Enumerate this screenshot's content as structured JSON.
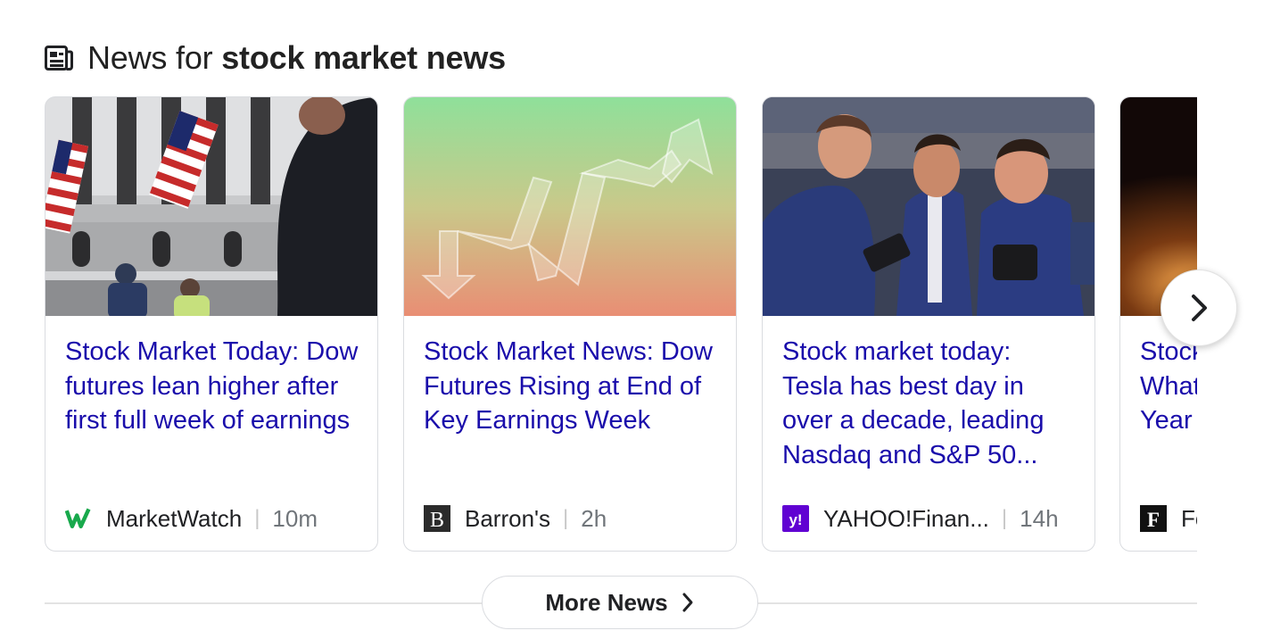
{
  "header": {
    "prefix": "News for ",
    "query": "stock market news"
  },
  "cards": [
    {
      "title": "Stock Market Today: Dow futures lean higher after first full week of earnings",
      "source": "MarketWatch",
      "age": "10m",
      "logo_icon": "marketwatch-logo",
      "logo_color": "#18a94c"
    },
    {
      "title": "Stock Market News: Dow Futures Rising at End of Key Earnings Week",
      "source": "Barron's",
      "age": "2h",
      "logo_icon": "barrons-logo",
      "logo_color": "#2b2b2b"
    },
    {
      "title": "Stock market today: Tesla has best day in over a decade, leading Nasdaq and S&P 50...",
      "source": "YAHOO!Finan...",
      "age": "14h",
      "logo_icon": "yahoo-logo",
      "logo_color": "#6001d2"
    },
    {
      "title": "Stock Market Predictions: What to Expect Next Year",
      "source": "Forbes",
      "age": "",
      "logo_icon": "forbes-logo",
      "logo_color": "#111111"
    }
  ],
  "more_news_label": "More News",
  "colors": {
    "link": "#1a0dab",
    "border": "#dadce0"
  },
  "icons": [
    "news-icon",
    "chevron-right-icon"
  ]
}
